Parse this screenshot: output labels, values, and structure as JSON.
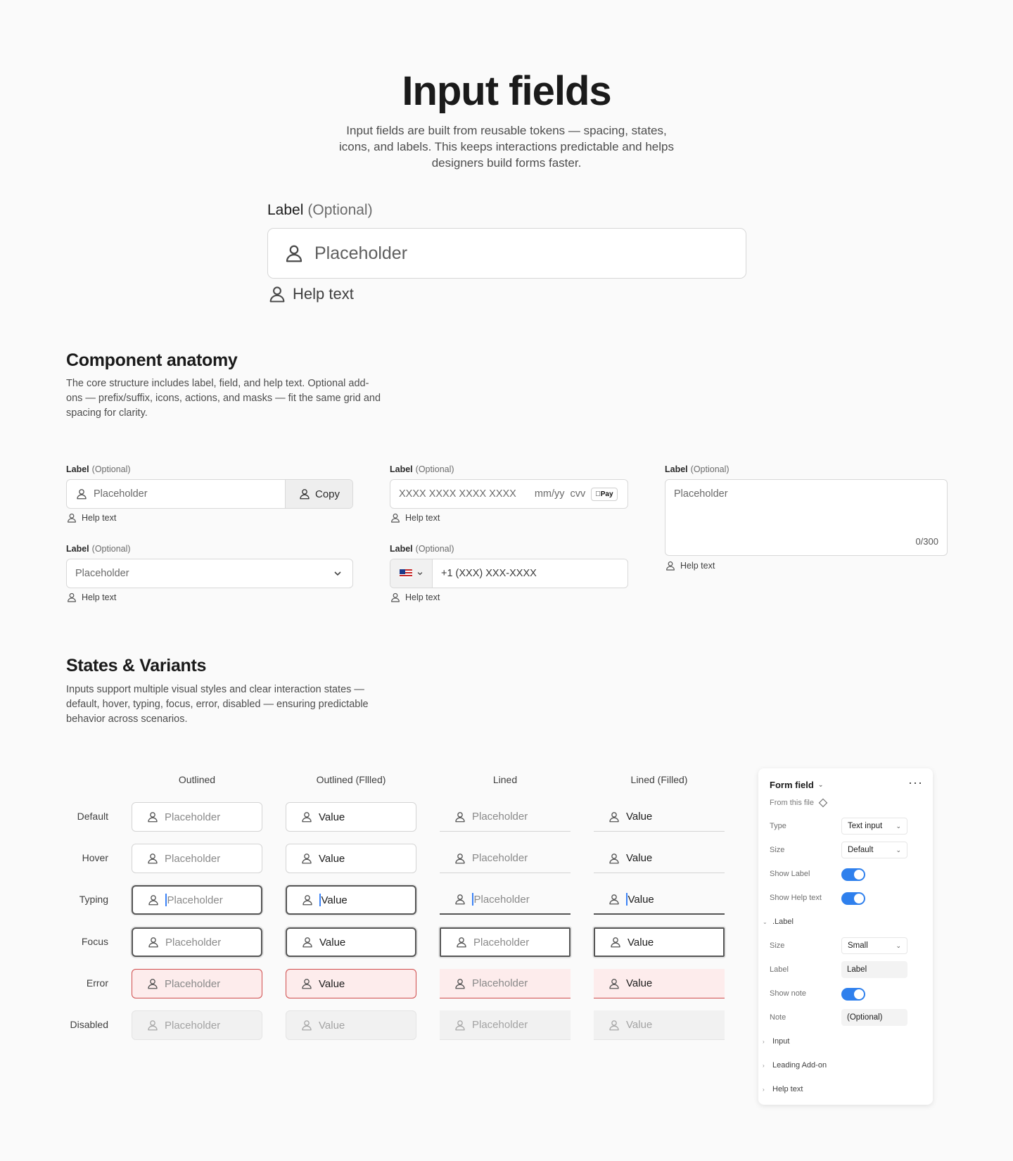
{
  "hero": {
    "title": "Input fields",
    "description": "Input fields are built from reusable tokens — spacing, states, icons, and labels. This keeps interactions predictable and helps designers build forms faster.",
    "label": "Label",
    "label_note": "(Optional)",
    "placeholder": "Placeholder",
    "help_text": "Help text"
  },
  "anatomy": {
    "title": "Component anatomy",
    "description": "The core structure includes label, field, and help text. Optional add-ons — prefix/suffix, icons, actions, and masks — fit the same grid and spacing for clarity.",
    "label": "Label",
    "label_note": "(Optional)",
    "help_text": "Help text",
    "copy_field": {
      "placeholder": "Placeholder",
      "action_label": "Copy"
    },
    "card_field": {
      "number_mask": "XXXX XXXX XXXX XXXX",
      "date_mask": "mm/yy",
      "cvv_mask": "cvv",
      "pay_badge": "Pay"
    },
    "textarea": {
      "placeholder": "Placeholder",
      "counter": "0/300"
    },
    "select_field": {
      "placeholder": "Placeholder"
    },
    "phone_field": {
      "mask": "+1 (XXX) XXX-XXXX",
      "country_flag": "us-flag-icon"
    }
  },
  "states": {
    "title": "States & Variants",
    "description": "Inputs support multiple visual styles and clear interaction states — default, hover, typing, focus, error, disabled — ensuring predictable behavior across scenarios.",
    "columns": [
      "Outlined",
      "Outlined (Fllled)",
      "Lined",
      "Lined (Filled)"
    ],
    "rows": [
      "Default",
      "Hover",
      "Typing",
      "Focus",
      "Error",
      "Disabled"
    ],
    "placeholder": "Placeholder",
    "value": "Value",
    "error_color": "#d04b4b",
    "focus_color": "#555555",
    "caret_color": "#3b82f6"
  },
  "panel": {
    "title": "Form field",
    "more": "···",
    "source": "From this file",
    "type_label": "Type",
    "type_value": "Text input",
    "size_label": "Size",
    "size_value": "Default",
    "show_label": "Show Label",
    "show_help": "Show Help text",
    "label_group": ".Label",
    "label_size_label": "Size",
    "label_size_value": "Small",
    "label_label": "Label",
    "label_value": "Label",
    "show_note": "Show note",
    "note_label": "Note",
    "note_value": "(Optional)",
    "group_input": "Input",
    "group_leading": "Leading Add-on",
    "group_help": "Help text",
    "toggle_color": "#2f80ed"
  }
}
